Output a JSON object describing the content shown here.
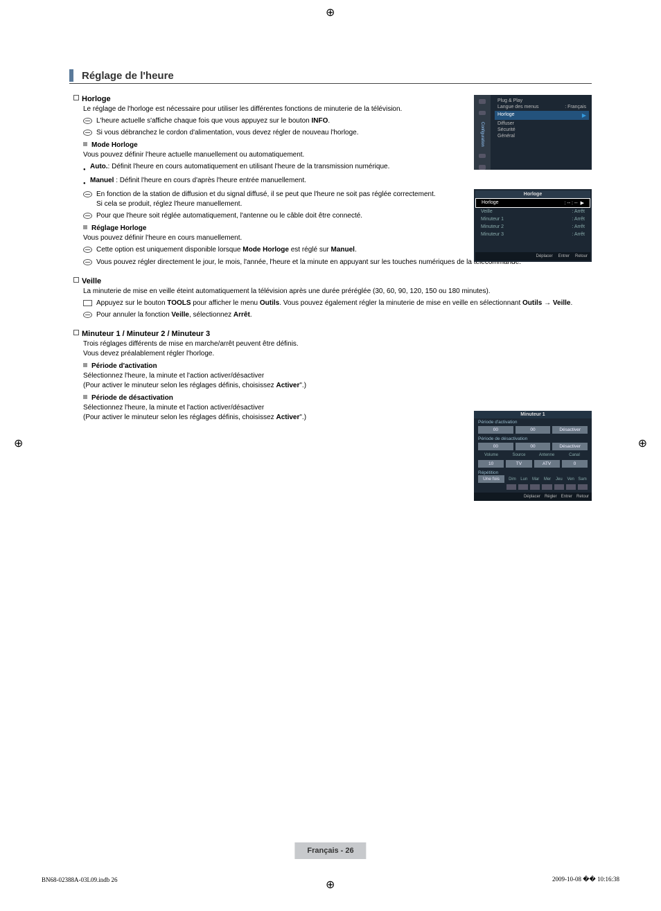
{
  "page_title": "Réglage de l'heure",
  "horloge": {
    "heading": "Horloge",
    "intro": "Le réglage de l'horloge est nécessaire pour utiliser les différentes fonctions de minuterie de la télévision.",
    "note1_pre": "L'heure actuelle s'affiche chaque fois que vous appuyez sur le bouton ",
    "note1_bold": "INFO",
    "note1_post": ".",
    "note2": "Si vous débranchez le cordon d'alimentation, vous devez régler de nouveau l'horloge.",
    "mode": {
      "heading": "Mode Horloge",
      "intro": "Vous pouvez définir l'heure actuelle manuellement ou automatiquement.",
      "auto_label": "Auto.",
      "auto_text": ": Définit l'heure en cours automatiquement en utilisant l'heure de la transmission numérique.",
      "manuel_label": "Manuel",
      "manuel_text": " : Définit l'heure en cours d'après l'heure entrée manuellement.",
      "note3": "En fonction de la station de diffusion et du signal diffusé, il se peut que l'heure ne soit pas réglée correctement. Si cela se produit, réglez l'heure manuellement.",
      "note4": "Pour que l'heure soit réglée automatiquement, l'antenne ou le câble doit être connecté."
    },
    "reglage": {
      "heading": "Réglage Horloge",
      "intro": "Vous pouvez définir l'heure en cours manuellement.",
      "note5_pre": "Cette option est uniquement disponible lorsque ",
      "note5_b1": "Mode Horloge",
      "note5_mid": " est réglé sur ",
      "note5_b2": "Manuel",
      "note5_post": ".",
      "note6": "Vous pouvez régler directement le jour, le mois, l'année, l'heure et la minute en appuyant sur les touches numériques de la télécommande."
    }
  },
  "veille": {
    "heading": "Veille",
    "intro": "La minuterie de mise en veille éteint automatiquement la télévision après une durée préréglée (30, 60, 90, 120, 150 ou 180 minutes).",
    "tool_pre": "Appuyez sur le bouton ",
    "tool_b1": "TOOLS",
    "tool_mid1": " pour afficher le menu ",
    "tool_b2": "Outils",
    "tool_mid2": ". Vous pouvez également régler la minuterie de mise en veille en sélectionnant ",
    "tool_b3": "Outils → Veille",
    "tool_post": ".",
    "note_pre": "Pour annuler la fonction ",
    "note_b1": "Veille",
    "note_mid": ", sélectionnez ",
    "note_b2": "Arrêt",
    "note_post": "."
  },
  "minuteur": {
    "heading": "Minuteur 1 / Minuteur 2 / Minuteur 3",
    "intro1": "Trois réglages différents de mise en marche/arrêt peuvent être définis.",
    "intro2": "Vous devez préalablement régler l'horloge.",
    "act": {
      "heading": "Période d'activation",
      "l1": "Sélectionnez l'heure, la minute et l'action activer/désactiver",
      "l2_pre": "(Pour activer le minuteur selon les réglages définis, choisissez ",
      "l2_b": "Activer",
      "l2_post": "\".)"
    },
    "deact": {
      "heading": "Période de désactivation",
      "l1": "Sélectionnez l'heure, la minute et l'action activer/désactiver",
      "l2_pre": "(Pour activer le minuteur selon les réglages définis, choisissez ",
      "l2_b": "Activer",
      "l2_post": "\".)"
    }
  },
  "osd1": {
    "tab_label": "Configuration",
    "plug": "Plug & Play",
    "langue_l": "Langue des menus",
    "langue_v": ": Français",
    "sel": "Horloge",
    "diffuser": "Diffuser",
    "securite": "Sécurité",
    "general": "Général"
  },
  "osd2": {
    "title": "Horloge",
    "rows": [
      {
        "l": "Horloge",
        "v": ": -- : --"
      },
      {
        "l": "Veille",
        "v": ": Arrêt"
      },
      {
        "l": "Minuteur 1",
        "v": ": Arrêt"
      },
      {
        "l": "Minuteur 2",
        "v": ": Arrêt"
      },
      {
        "l": "Minuteur 3",
        "v": ": Arrêt"
      }
    ],
    "footer": [
      "Déplacer",
      "Entrer",
      "Retour"
    ]
  },
  "osd3": {
    "title": "Minuteur 1",
    "act_label": "Période d'activation",
    "act_cells": [
      "00",
      "00",
      "Désactiver"
    ],
    "deact_label": "Période de désactivation",
    "deact_cells": [
      "00",
      "00",
      "Désactiver"
    ],
    "headers": [
      "Volume",
      "Source",
      "Antenne",
      "Canal"
    ],
    "vals": [
      "10",
      "TV",
      "ATV",
      "0"
    ],
    "rep_label": "Répétition",
    "rep_val": "Une fois",
    "days": [
      "Dim",
      "Lun",
      "Mar",
      "Mer",
      "Jeu",
      "Ven",
      "Sam"
    ],
    "footer": [
      "Déplacer",
      "Régler",
      "Entrer",
      "Retour"
    ]
  },
  "page_footer": "Français - 26",
  "doc_id": "BN68-02388A-03L09.indb   26",
  "doc_ts": "2009-10-08   �� 10:16:38"
}
